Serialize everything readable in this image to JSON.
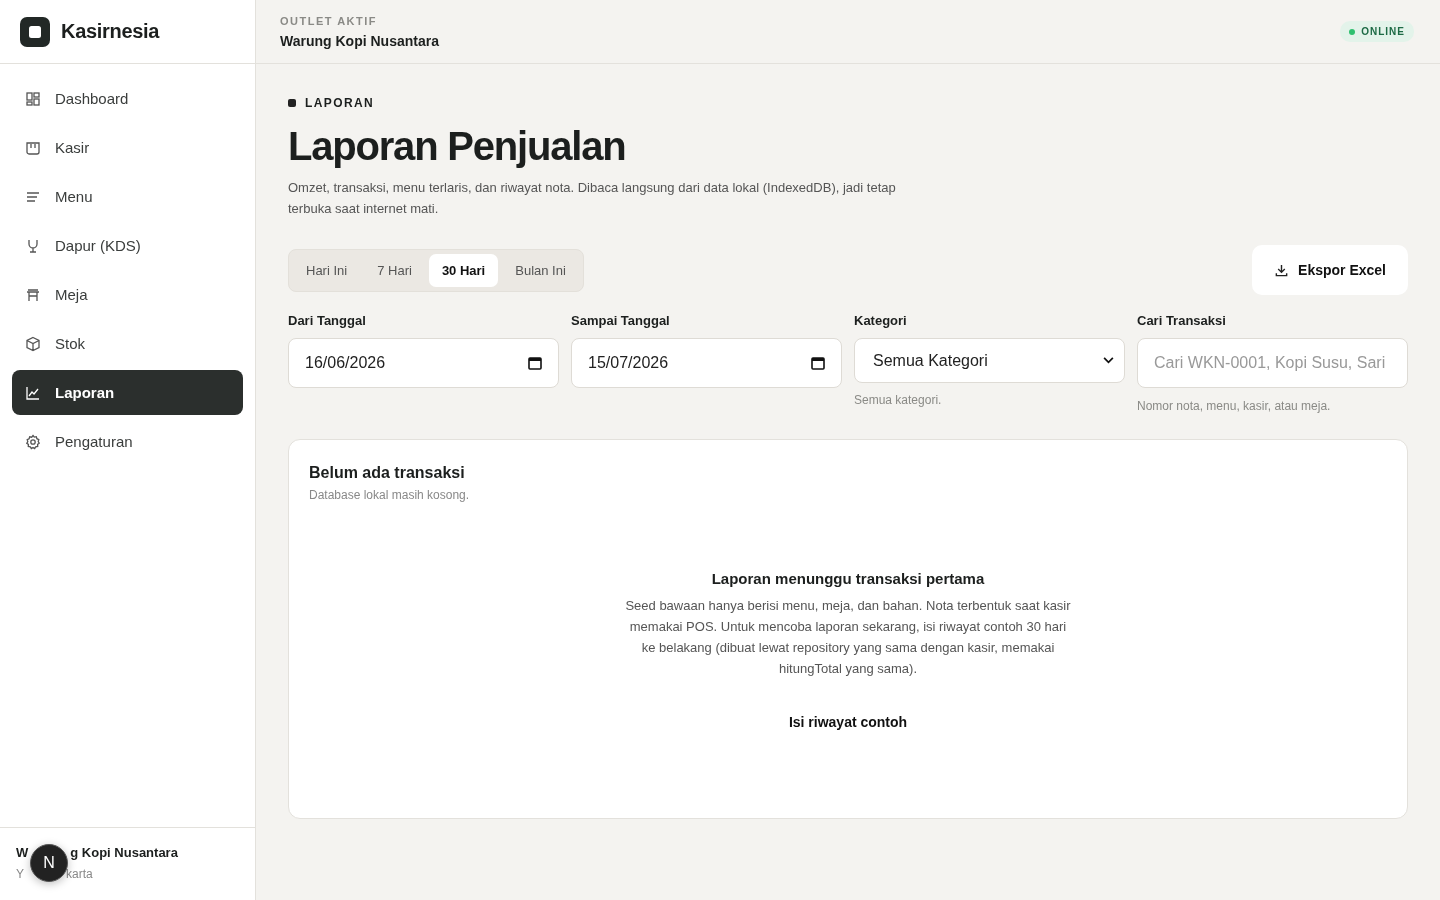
{
  "brand": {
    "name": "Kasirnesia"
  },
  "topbar": {
    "label": "OUTLET AKTIF",
    "outlet": "Warung Kopi Nusantara",
    "status": {
      "text": "ONLINE",
      "online": true
    }
  },
  "sidebar": {
    "items": [
      {
        "label": "Dashboard",
        "selected": false
      },
      {
        "label": "Kasir",
        "selected": false
      },
      {
        "label": "Menu",
        "selected": false
      },
      {
        "label": "Dapur (KDS)",
        "selected": false
      },
      {
        "label": "Meja",
        "selected": false
      },
      {
        "label": "Stok",
        "selected": false
      },
      {
        "label": "Laporan",
        "selected": true
      },
      {
        "label": "Pengaturan",
        "selected": false
      }
    ],
    "footer": {
      "name_start": "W",
      "name_end": "g Kopi Nusantara",
      "city_start": "Y",
      "city_end": "karta",
      "avatar": "N"
    }
  },
  "page": {
    "eyebrow": "LAPORAN",
    "title": "Laporan Penjualan",
    "description": "Omzet, transaksi, menu terlaris, dan riwayat nota. Dibaca langsung dari data lokal (IndexedDB), jadi tetap terbuka saat internet mati."
  },
  "ranges": [
    {
      "label": "Hari Ini",
      "selected": false
    },
    {
      "label": "7 Hari",
      "selected": false
    },
    {
      "label": "30 Hari",
      "selected": true
    },
    {
      "label": "Bulan Ini",
      "selected": false
    }
  ],
  "export_button": "Ekspor Excel",
  "filters": [
    {
      "kind": "date",
      "label": "Dari Tanggal",
      "value": "16/06/2026"
    },
    {
      "kind": "date",
      "label": "Sampai Tanggal",
      "value": "15/07/2026"
    },
    {
      "kind": "select",
      "label": "Kategori",
      "value": "Semua Kategori",
      "hint": "Semua kategori."
    },
    {
      "kind": "search",
      "label": "Cari Transaksi",
      "placeholder": "Cari WKN-0001, Kopi Susu, Sari",
      "hint": "Nomor nota, menu, kasir, atau meja."
    }
  ],
  "card": {
    "title": "Belum ada transaksi",
    "subtitle": "Database lokal masih kosong.",
    "empty_title": "Laporan menunggu transaksi pertama",
    "empty_text": "Seed bawaan hanya berisi menu, meja, dan bahan. Nota terbentuk saat kasir memakai POS. Untuk mencoba laporan sekarang, isi riwayat contoh 30 hari ke belakang (dibuat lewat repository yang sama dengan kasir, memakai hitungTotal yang sama).",
    "action": "Isi riwayat contoh"
  }
}
